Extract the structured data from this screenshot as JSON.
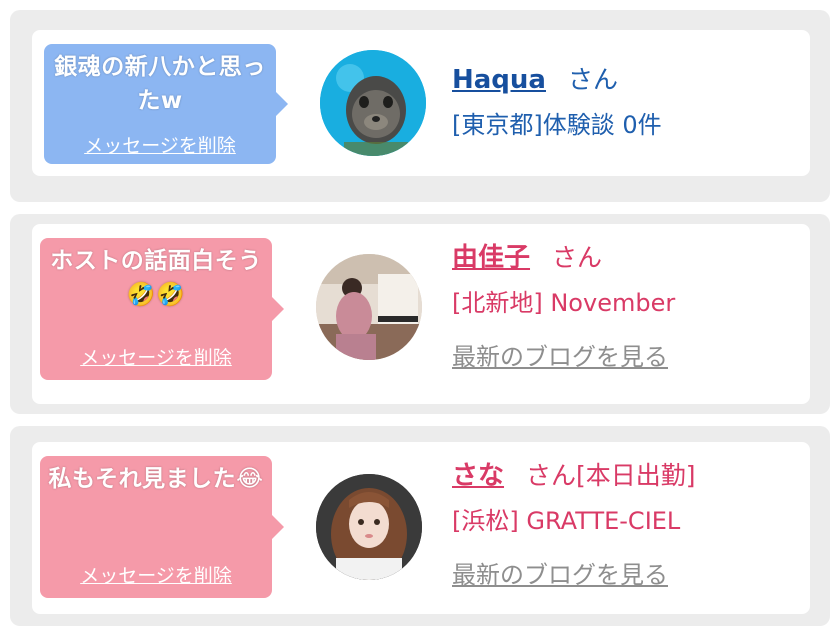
{
  "colors": {
    "user_bubble": "#8cb6f2",
    "cast_bubble": "#f59aa9",
    "user_text": "#1f5fae",
    "cast_text": "#d93a66",
    "blog_link": "#8e8e8e"
  },
  "delete_label": "メッセージを削除",
  "san_label": "さん",
  "blog_label": "最新のブログを見る",
  "messages": [
    {
      "message": "銀魂の新八かと思ったw",
      "name": "Haqua",
      "suffix": "",
      "detail": "[東京都]体験談 0件",
      "avatar": "seal-avatar"
    },
    {
      "message": "ホストの話面白そう🤣🤣",
      "name": "由佳子",
      "suffix": "",
      "detail": "[北新地] November",
      "avatar": "piano-avatar"
    },
    {
      "message": "私もそれ見ました😂",
      "name": "さな",
      "suffix": "[本日出勤]",
      "detail": "[浜松] GRATTE-CIEL",
      "avatar": "girl-avatar"
    }
  ]
}
